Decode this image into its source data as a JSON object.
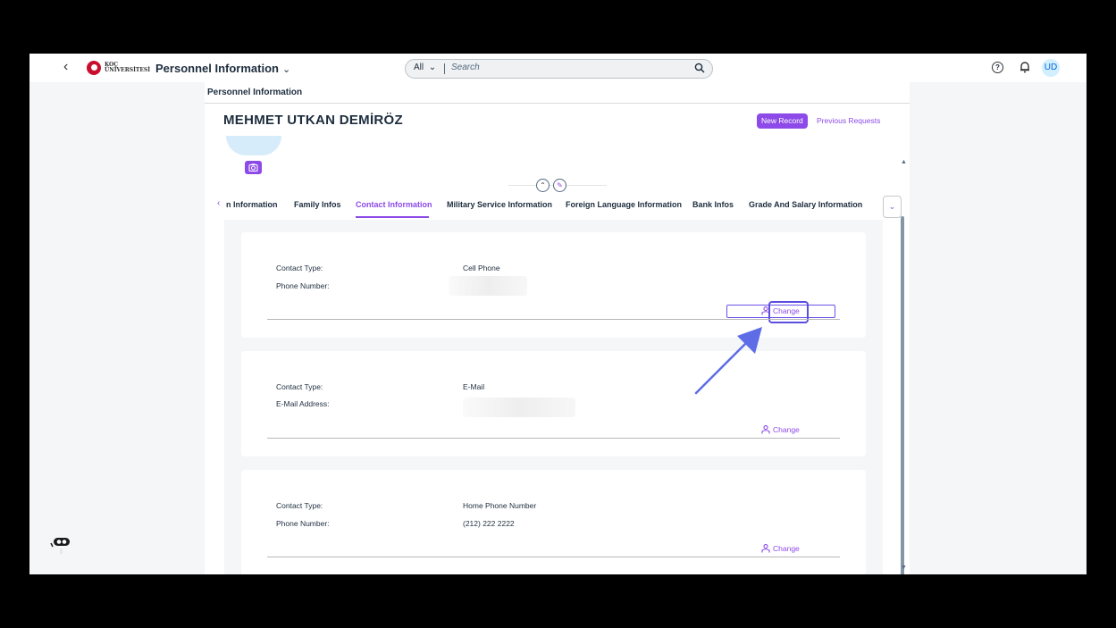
{
  "shell": {
    "logo_text_line1": "KOÇ",
    "logo_text_line2": "ÜNİVERSİTESİ",
    "app_title": "Personnel Information",
    "search_scope": "All",
    "search_placeholder": "Search",
    "help_glyph": "?",
    "avatar_initials": "UD"
  },
  "page": {
    "breadcrumb_title": "Personnel Information",
    "employee_name": "MEHMET UTKAN DEMİRÖZ",
    "new_record_label": "New Record",
    "previous_requests_label": "Previous Requests",
    "collapse_glyph": "⌃",
    "pin_glyph": "✎"
  },
  "tabs": [
    {
      "label": "n Information"
    },
    {
      "label": "Family Infos"
    },
    {
      "label": "Contact Information",
      "active": true
    },
    {
      "label": "Military Service Information"
    },
    {
      "label": "Foreign Language Information"
    },
    {
      "label": "Bank Infos"
    },
    {
      "label": "Grade And Salary Information"
    }
  ],
  "contacts": [
    {
      "type_label": "Contact Type:",
      "type_value": "Cell Phone",
      "detail_label": "Phone Number:",
      "detail_value": "",
      "change_label": "Change"
    },
    {
      "type_label": "Contact Type:",
      "type_value": "E-Mail",
      "detail_label": "E-Mail Address:",
      "detail_value": "",
      "change_label": "Change"
    },
    {
      "type_label": "Contact Type:",
      "type_value": "Home Phone Number",
      "detail_label": "Phone Number:",
      "detail_value": "(212) 222 2222",
      "change_label": "Change"
    }
  ],
  "colors": {
    "accent": "#8d4ae8",
    "highlight": "#5b4de0",
    "annotation_arrow": "#5e6ce6"
  }
}
